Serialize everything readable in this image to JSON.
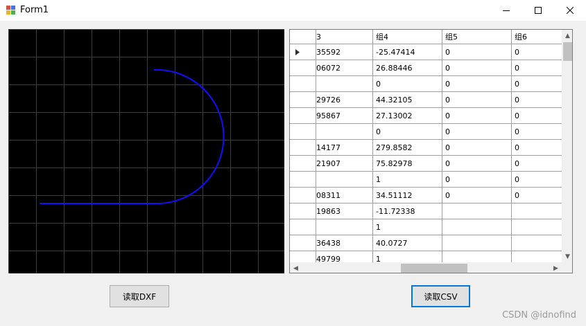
{
  "window": {
    "title": "Form1",
    "buttons": [
      "minimize",
      "maximize",
      "close"
    ]
  },
  "grid": {
    "columns": [
      "3",
      "组4",
      "组5",
      "组6"
    ],
    "rows": [
      {
        "c3": "35592",
        "c4": "-25.47414",
        "c5": "0",
        "c6": "0",
        "current": true
      },
      {
        "c3": "06072",
        "c4": "26.88446",
        "c5": "0",
        "c6": "0"
      },
      {
        "c3": "",
        "c4": "0",
        "c5": "0",
        "c6": "0"
      },
      {
        "c3": "29726",
        "c4": "44.32105",
        "c5": "0",
        "c6": "0"
      },
      {
        "c3": "95867",
        "c4": "27.13002",
        "c5": "0",
        "c6": "0"
      },
      {
        "c3": "",
        "c4": "0",
        "c5": "0",
        "c6": "0"
      },
      {
        "c3": "14177",
        "c4": "279.8582",
        "c5": "0",
        "c6": "0"
      },
      {
        "c3": "21907",
        "c4": "75.82978",
        "c5": "0",
        "c6": "0"
      },
      {
        "c3": "",
        "c4": "1",
        "c5": "0",
        "c6": "0"
      },
      {
        "c3": "08311",
        "c4": "34.51112",
        "c5": "0",
        "c6": "0"
      },
      {
        "c3": "19863",
        "c4": "-11.72338",
        "c5": "",
        "c6": ""
      },
      {
        "c3": "",
        "c4": "1",
        "c5": "",
        "c6": ""
      },
      {
        "c3": "36438",
        "c4": "40.0727",
        "c5": "",
        "c6": ""
      },
      {
        "c3": "49799",
        "c4": "1",
        "c5": "",
        "c6": ""
      }
    ]
  },
  "buttons": {
    "read_dxf": "读取DXF",
    "read_csv": "读取CSV"
  },
  "watermark": "CSDN @idnofind",
  "colors": {
    "canvas_bg": "#000000",
    "grid_lines": "#3c3c3c",
    "curve": "#0000ff",
    "focus": "#0078d7"
  },
  "icons": {
    "current_row": "triangle-right-icon",
    "scroll_up": "chevron-up-icon",
    "scroll_down": "chevron-down-icon",
    "scroll_left": "chevron-left-icon",
    "scroll_right": "chevron-right-icon"
  }
}
